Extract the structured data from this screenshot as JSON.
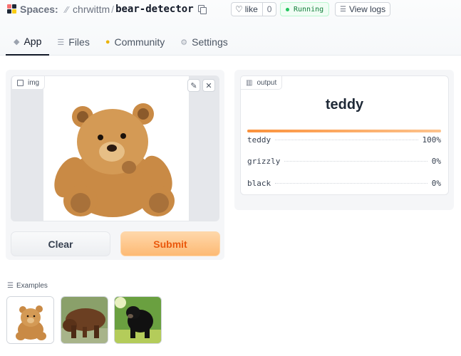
{
  "header": {
    "spaces_label": "Spaces:",
    "owner": "chrwittm",
    "slash": "/",
    "repo": "bear-detector",
    "like_label": "like",
    "like_count": "0",
    "status": "Running",
    "view_logs": "View logs"
  },
  "tabs": [
    {
      "label": "App",
      "icon": "cube-icon"
    },
    {
      "label": "Files",
      "icon": "files-icon"
    },
    {
      "label": "Community",
      "icon": "community-icon"
    },
    {
      "label": "Settings",
      "icon": "gear-icon"
    }
  ],
  "input": {
    "label": "img",
    "clear_label": "Clear",
    "submit_label": "Submit"
  },
  "output": {
    "label": "output",
    "prediction": "teddy",
    "top_confidence": 1.0,
    "confidences": [
      {
        "label": "teddy",
        "value": "100%"
      },
      {
        "label": "grizzly",
        "value": "0%"
      },
      {
        "label": "black",
        "value": "0%"
      }
    ]
  },
  "examples": {
    "label": "Examples",
    "items": [
      "teddy-bear-image",
      "grizzly-bear-image",
      "black-bear-image"
    ]
  },
  "colors": {
    "accent": "#fb923c",
    "submit_text": "#ea580c",
    "running": "#22c55e"
  }
}
